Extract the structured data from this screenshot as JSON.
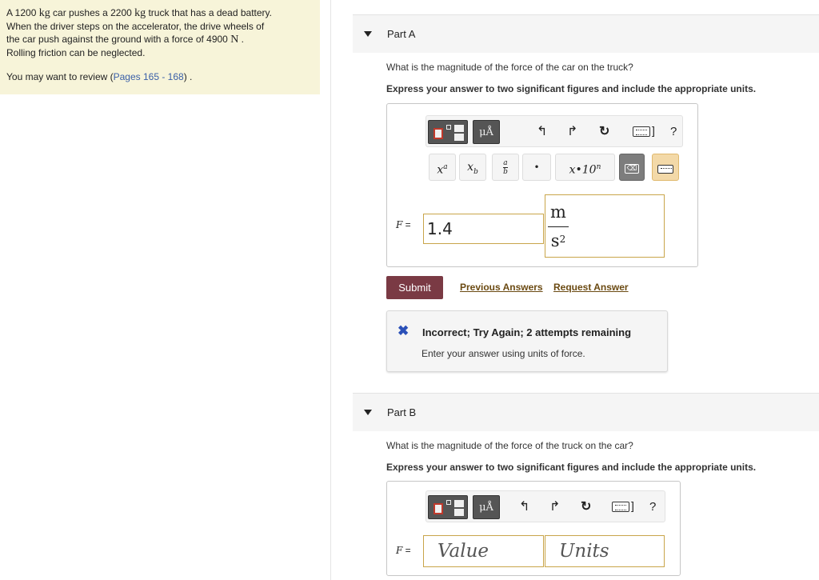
{
  "problem": {
    "line1_a": "A 1200 ",
    "unit_kg": "kg",
    "line1_b": " car pushes a 2200 ",
    "line1_c": " truck that has a dead battery.",
    "line2": "When the driver steps on the accelerator, the drive wheels of",
    "line3_a": "the car push against the ground with a force of 4900 ",
    "unit_N": "N",
    "line3_b": " .",
    "line4": "Rolling friction can be neglected.",
    "review_prefix": "You may want to review (",
    "review_link": "Pages 165 - 168",
    "review_suffix": ") ."
  },
  "part_a": {
    "title": "Part A",
    "question": "What is the magnitude of the force of the car on the truck?",
    "instruction": "Express your answer to two significant figures and include the appropriate units.",
    "toolbar": {
      "units_button": "μÅ",
      "undo_icon": "↰",
      "redo_icon": "↱",
      "reset_icon": "↻",
      "bracket": "]",
      "help": "?"
    },
    "symbols": {
      "power_base": "x",
      "power_exp": "a",
      "sub_base": "x",
      "sub_idx": "b",
      "frac_num": "a",
      "frac_den": "b",
      "dot": "•",
      "sci": "x•10",
      "sci_exp": "n",
      "delete": "⌫"
    },
    "label_var": "F",
    "label_eq": " =",
    "value": "1.4",
    "unit_numerator": "m",
    "unit_denominator": "s",
    "unit_den_exp": "2",
    "submit_label": "Submit",
    "previous_answers": "Previous Answers",
    "request_answer": "Request Answer",
    "feedback": {
      "icon": "✖",
      "title": "Incorrect; Try Again; 2 attempts remaining",
      "message": "Enter your answer using units of force."
    }
  },
  "part_b": {
    "title": "Part B",
    "question": "What is the magnitude of the force of the truck on the car?",
    "instruction": "Express your answer to two significant figures and include the appropriate units.",
    "toolbar": {
      "units_button": "μÅ",
      "undo_icon": "↰",
      "redo_icon": "↱",
      "reset_icon": "↻",
      "bracket": "]",
      "help": "?"
    },
    "label_var": "F",
    "label_eq": " =",
    "value_placeholder": "Value",
    "units_placeholder": "Units"
  },
  "colors": {
    "problem_bg": "#f7f4d9",
    "submit_bg": "#7a3a44",
    "input_border": "#c9a54a",
    "feedback_icon": "#2a50b8"
  }
}
